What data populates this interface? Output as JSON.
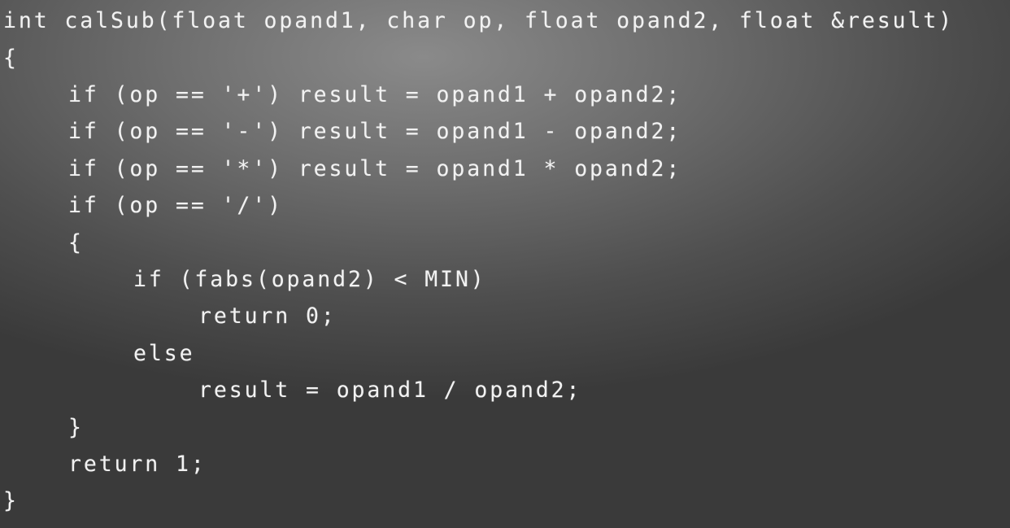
{
  "code": {
    "lines": [
      "int calSub(float opand1, char op, float opand2, float &result)",
      "{",
      "if (op == '+') result = opand1 + opand2;",
      "if (op == '-') result = opand1 - opand2;",
      "if (op == '*') result = opand1 * opand2;",
      "if (op == '/')",
      "{",
      "if (fabs(opand2) < MIN)",
      "return 0;",
      "else",
      "result = opand1 / opand2;",
      "}",
      "return 1;",
      "}"
    ]
  }
}
